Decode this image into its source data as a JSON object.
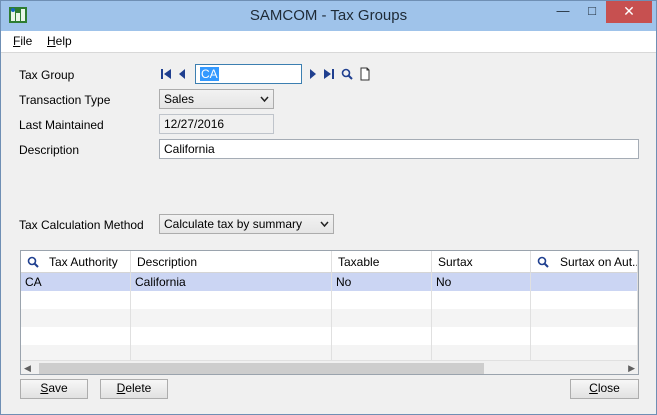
{
  "window": {
    "title": "SAMCOM - Tax Groups",
    "minimize": "—",
    "maximize": "□",
    "close": "✕"
  },
  "menu": [
    {
      "label": "File",
      "key": "F",
      "rest": "ile"
    },
    {
      "label": "Help",
      "key": "H",
      "rest": "elp"
    }
  ],
  "form": {
    "tax_group_label": "Tax Group",
    "tax_group_value": "CA",
    "transaction_type_label": "Transaction Type",
    "transaction_type_value": "Sales",
    "last_maintained_label": "Last Maintained",
    "last_maintained_value": "12/27/2016",
    "description_label": "Description",
    "description_value": "California",
    "tax_calc_label": "Tax Calculation Method",
    "tax_calc_value": "Calculate tax by summary"
  },
  "grid": {
    "columns": [
      "Tax Authority",
      "Description",
      "Taxable",
      "Surtax",
      "Surtax on Aut..."
    ],
    "rows": [
      [
        "CA",
        "California",
        "No",
        "No",
        ""
      ]
    ],
    "left_arrow": "◀",
    "right_arrow": "▶"
  },
  "buttons": {
    "save": {
      "key": "S",
      "rest": "ave"
    },
    "delete": {
      "key": "D",
      "rest": "elete"
    },
    "close": {
      "key": "C",
      "rest": "lose"
    }
  },
  "colors": {
    "titlebar": "#9fc3ea",
    "selected_row": "#cbd5f3",
    "close_button": "#c75050",
    "selection": "#3399ff"
  }
}
